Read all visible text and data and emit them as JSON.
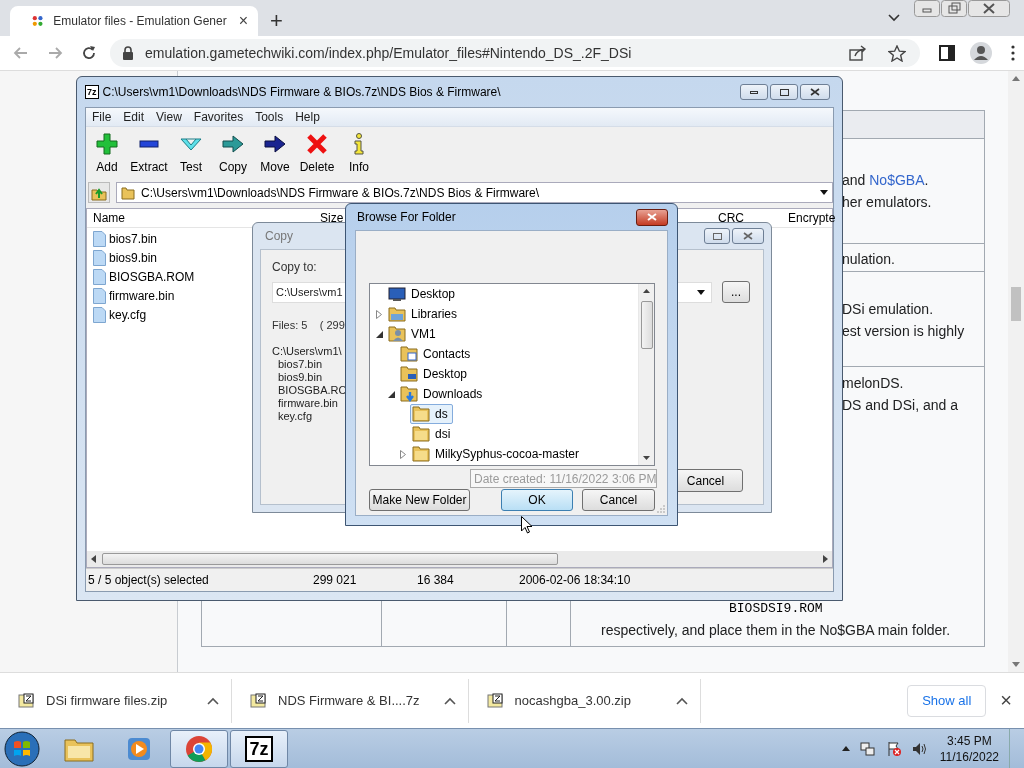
{
  "browser": {
    "tab_title": "Emulator files - Emulation Gener",
    "tab_close": "×",
    "new_tab": "+",
    "url": "emulation.gametechwiki.com/index.php/Emulator_files#Nintendo_DS_.2F_DSi"
  },
  "page": {
    "rows": [
      {
        "lines": [
          [
            {
              "text": "and "
            },
            {
              "text": "No$GBA",
              "link": true
            },
            {
              "text": "."
            }
          ],
          [
            {
              "text": "her emulators."
            }
          ]
        ]
      },
      {
        "lines": [
          [
            {
              "text": "nulation."
            }
          ]
        ]
      },
      {
        "lines": [
          [
            {
              "text": "DSi emulation."
            }
          ],
          [
            {
              "text": "est version is highly"
            }
          ]
        ]
      },
      {
        "lines": [
          [
            {
              "text": "melonDS."
            }
          ],
          [
            {
              "text": "DS and DSi, and a"
            }
          ]
        ],
        "code": "BIOSDSI9.ROM",
        "footer": "respectively, and place them in the No$GBA main folder."
      }
    ]
  },
  "archive_window": {
    "icon_text": "7z",
    "title": "C:\\Users\\vm1\\Downloads\\NDS Firmware & BIOs.7z\\NDS Bios & Firmware\\",
    "menu": [
      "File",
      "Edit",
      "View",
      "Favorites",
      "Tools",
      "Help"
    ],
    "toolbar": [
      {
        "label": "Add",
        "kind": "add"
      },
      {
        "label": "Extract",
        "kind": "extract"
      },
      {
        "label": "Test",
        "kind": "test"
      },
      {
        "label": "Copy",
        "kind": "copy"
      },
      {
        "label": "Move",
        "kind": "move"
      },
      {
        "label": "Delete",
        "kind": "delete"
      },
      {
        "label": "Info",
        "kind": "info"
      }
    ],
    "path": "C:\\Users\\vm1\\Downloads\\NDS Firmware & BIOs.7z\\NDS Bios & Firmware\\",
    "columns": [
      "Name",
      "Size",
      "CRC",
      "Encrypte"
    ],
    "files": [
      "bios7.bin",
      "bios9.bin",
      "BIOSGBA.ROM",
      "firmware.bin",
      "key.cfg"
    ],
    "status": [
      "5 / 5 object(s) selected",
      "299 021",
      "16 384",
      "2006-02-06 18:34:10"
    ]
  },
  "copy_dialog": {
    "title": "Copy",
    "copy_to_label": "Copy to:",
    "copy_to_value": "C:\\Users\\vm1",
    "files_info": "Files: 5    ( 299",
    "listing": [
      "C:\\Users\\vm1\\",
      "bios7.bin",
      "bios9.bin",
      "BIOSGBA.RO",
      "firmware.bin",
      "key.cfg"
    ],
    "browse_button": "...",
    "cancel_button": "Cancel"
  },
  "browse_dialog": {
    "title": "Browse For Folder",
    "tree": [
      {
        "label": "Desktop",
        "kind": "desktop",
        "selected": false
      },
      {
        "label": "Libraries",
        "kind": "library",
        "expanded": false,
        "selected": false
      },
      {
        "label": "VM1",
        "kind": "user",
        "expanded": true,
        "selected": false,
        "children": [
          {
            "label": "Contacts",
            "kind": "contacts",
            "selected": false
          },
          {
            "label": "Desktop",
            "kind": "desktop-folder",
            "selected": false
          },
          {
            "label": "Downloads",
            "kind": "downloads",
            "expanded": true,
            "selected": false,
            "children": [
              {
                "label": "ds",
                "kind": "folder",
                "selected": true
              },
              {
                "label": "dsi",
                "kind": "folder",
                "selected": false
              },
              {
                "label": "MilkySyphus-cocoa-master",
                "kind": "folder",
                "expanded": false,
                "selected": false
              }
            ]
          }
        ]
      }
    ],
    "new_folder_button": "Make New Folder",
    "ok_button": "OK",
    "cancel_button": "Cancel",
    "tooltip": "Date created: 11/16/2022 3:06 PM"
  },
  "downloads": {
    "items": [
      "DSi firmware files.zip",
      "NDS Firmware & BI....7z",
      "nocashgba_3.00.zip"
    ],
    "show_all": "Show all",
    "close": "×"
  },
  "taskbar": {
    "apps": [
      {
        "kind": "explorer",
        "active": false
      },
      {
        "kind": "media",
        "active": false
      },
      {
        "kind": "browser",
        "active": true
      },
      {
        "kind": "archive",
        "active": true,
        "label": "7z"
      }
    ],
    "time": "3:45 PM",
    "date": "11/16/2022"
  }
}
